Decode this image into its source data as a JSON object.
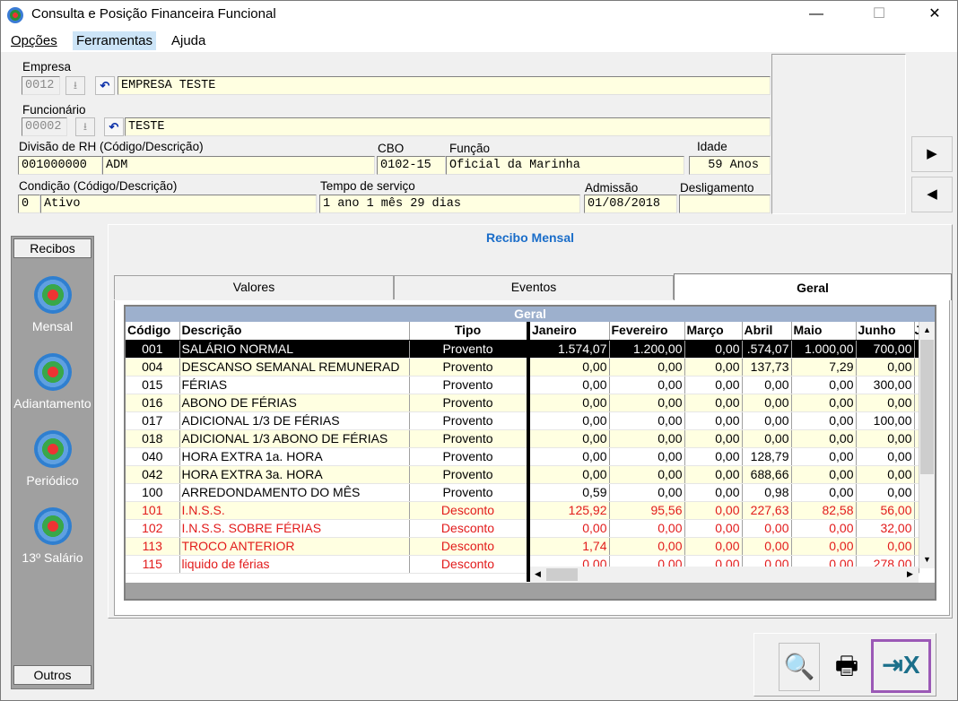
{
  "window": {
    "title": "Consulta e Posição Financeira Funcional",
    "minimize": "—",
    "maximize": "☐",
    "close": "✕"
  },
  "menu": [
    "Opções",
    "Ferramentas",
    "Ajuda"
  ],
  "form": {
    "empresa_label": "Empresa",
    "empresa_code": "0012",
    "empresa_name": "EMPRESA TESTE",
    "funcionario_label": "Funcionário",
    "funcionario_code": "00002",
    "funcionario_name": "TESTE",
    "divisao_label": "Divisão de RH (Código/Descrição)",
    "divisao_code": "001000000",
    "divisao_desc": "ADM",
    "cbo_label": "CBO",
    "cbo": "0102-15",
    "funcao_label": "Função",
    "funcao": "Oficial da Marinha",
    "idade_label": "Idade",
    "idade": "59 Anos",
    "condicao_label": "Condição (Código/Descrição)",
    "condicao_code": "0",
    "condicao_desc": "Ativo",
    "tempo_label": "Tempo de serviço",
    "tempo": "1 ano 1 mês 29 dias",
    "admissao_label": "Admissão",
    "admissao": "01/08/2018",
    "desligamento_label": "Desligamento",
    "desligamento": ""
  },
  "sidebar": {
    "header": "Recibos",
    "items": [
      "Mensal",
      "Adiantamento",
      "Periódico",
      "13º Salário"
    ],
    "footer": "Outros"
  },
  "panel": {
    "title": "Recibo Mensal",
    "tabs": [
      "Valores",
      "Eventos",
      "Geral"
    ],
    "grid_title": "Geral"
  },
  "table": {
    "columns": [
      "Código",
      "Descrição",
      "Tipo",
      "Janeiro",
      "Fevereiro",
      "Março",
      "Abril",
      "Maio",
      "Junho",
      "J"
    ],
    "rows": [
      [
        "001",
        "SALÁRIO NORMAL",
        "Provento",
        "1.574,07",
        "1.200,00",
        "0,00",
        ".574,07",
        "1.000,00",
        "700,00"
      ],
      [
        "004",
        "DESCANSO SEMANAL REMUNERAD",
        "Provento",
        "0,00",
        "0,00",
        "0,00",
        "137,73",
        "7,29",
        "0,00"
      ],
      [
        "015",
        "FÉRIAS",
        "Provento",
        "0,00",
        "0,00",
        "0,00",
        "0,00",
        "0,00",
        "300,00"
      ],
      [
        "016",
        "ABONO DE FÉRIAS",
        "Provento",
        "0,00",
        "0,00",
        "0,00",
        "0,00",
        "0,00",
        "0,00"
      ],
      [
        "017",
        "ADICIONAL 1/3 DE FÉRIAS",
        "Provento",
        "0,00",
        "0,00",
        "0,00",
        "0,00",
        "0,00",
        "100,00"
      ],
      [
        "018",
        "ADICIONAL 1/3 ABONO DE FÉRIAS",
        "Provento",
        "0,00",
        "0,00",
        "0,00",
        "0,00",
        "0,00",
        "0,00"
      ],
      [
        "040",
        "HORA EXTRA 1a. HORA",
        "Provento",
        "0,00",
        "0,00",
        "0,00",
        "128,79",
        "0,00",
        "0,00"
      ],
      [
        "042",
        "HORA EXTRA 3a. HORA",
        "Provento",
        "0,00",
        "0,00",
        "0,00",
        "688,66",
        "0,00",
        "0,00"
      ],
      [
        "100",
        "ARREDONDAMENTO DO MÊS",
        "Provento",
        "0,59",
        "0,00",
        "0,00",
        "0,98",
        "0,00",
        "0,00"
      ],
      [
        "101",
        "I.N.S.S.",
        "Desconto",
        "125,92",
        "95,56",
        "0,00",
        "227,63",
        "82,58",
        "56,00"
      ],
      [
        "102",
        "I.N.S.S. SOBRE FÉRIAS",
        "Desconto",
        "0,00",
        "0,00",
        "0,00",
        "0,00",
        "0,00",
        "32,00"
      ],
      [
        "113",
        "TROCO ANTERIOR",
        "Desconto",
        "1,74",
        "0,00",
        "0,00",
        "0,00",
        "0,00",
        "0,00"
      ],
      [
        "115",
        "liquido de férias",
        "Desconto",
        "0,00",
        "0,00",
        "0,00",
        "0,00",
        "0,00",
        "278,00"
      ]
    ]
  },
  "colors": {
    "field_bg": "#ffffe1",
    "accent": "#1a6dc9",
    "desconto": "#e21b1b",
    "sidebar": "#a0a0a0",
    "highlight_border": "#9b59b6"
  }
}
